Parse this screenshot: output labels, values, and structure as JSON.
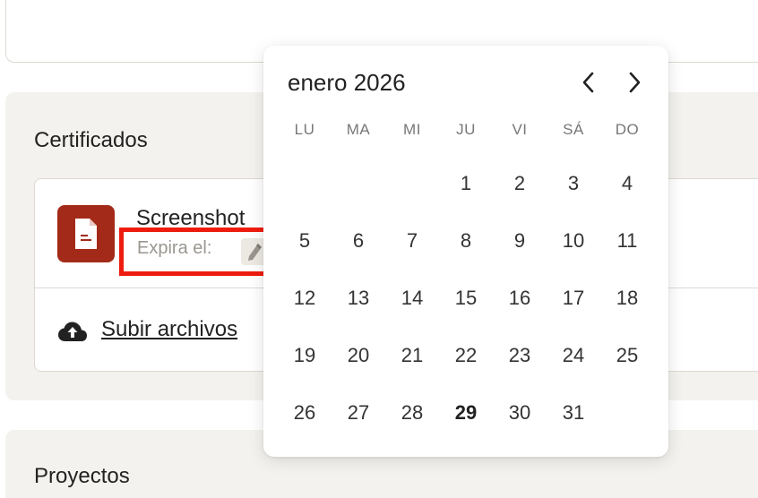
{
  "sections": {
    "certificates": {
      "title": "Certificados"
    },
    "projects": {
      "title": "Proyectos"
    }
  },
  "certificate": {
    "file_name": "Screenshot",
    "expires_label": "Expira el:",
    "file_icon": "document-icon",
    "edit_icon": "pencil-icon",
    "icon_color": "#a32a18"
  },
  "upload": {
    "label": "Subir archivos",
    "icon": "cloud-upload-icon"
  },
  "calendar": {
    "month_label": "enero 2026",
    "weekdays": [
      "LU",
      "MA",
      "MI",
      "JU",
      "VI",
      "SÁ",
      "DO"
    ],
    "weeks": [
      [
        "",
        "",
        "",
        "1",
        "2",
        "3",
        "4"
      ],
      [
        "5",
        "6",
        "7",
        "8",
        "9",
        "10",
        "11"
      ],
      [
        "12",
        "13",
        "14",
        "15",
        "16",
        "17",
        "18"
      ],
      [
        "19",
        "20",
        "21",
        "22",
        "23",
        "24",
        "25"
      ],
      [
        "26",
        "27",
        "28",
        "29",
        "30",
        "31",
        ""
      ]
    ],
    "today": "29",
    "prev_icon": "chevron-left-icon",
    "next_icon": "chevron-right-icon"
  },
  "highlight_color": "#ee1c0e"
}
